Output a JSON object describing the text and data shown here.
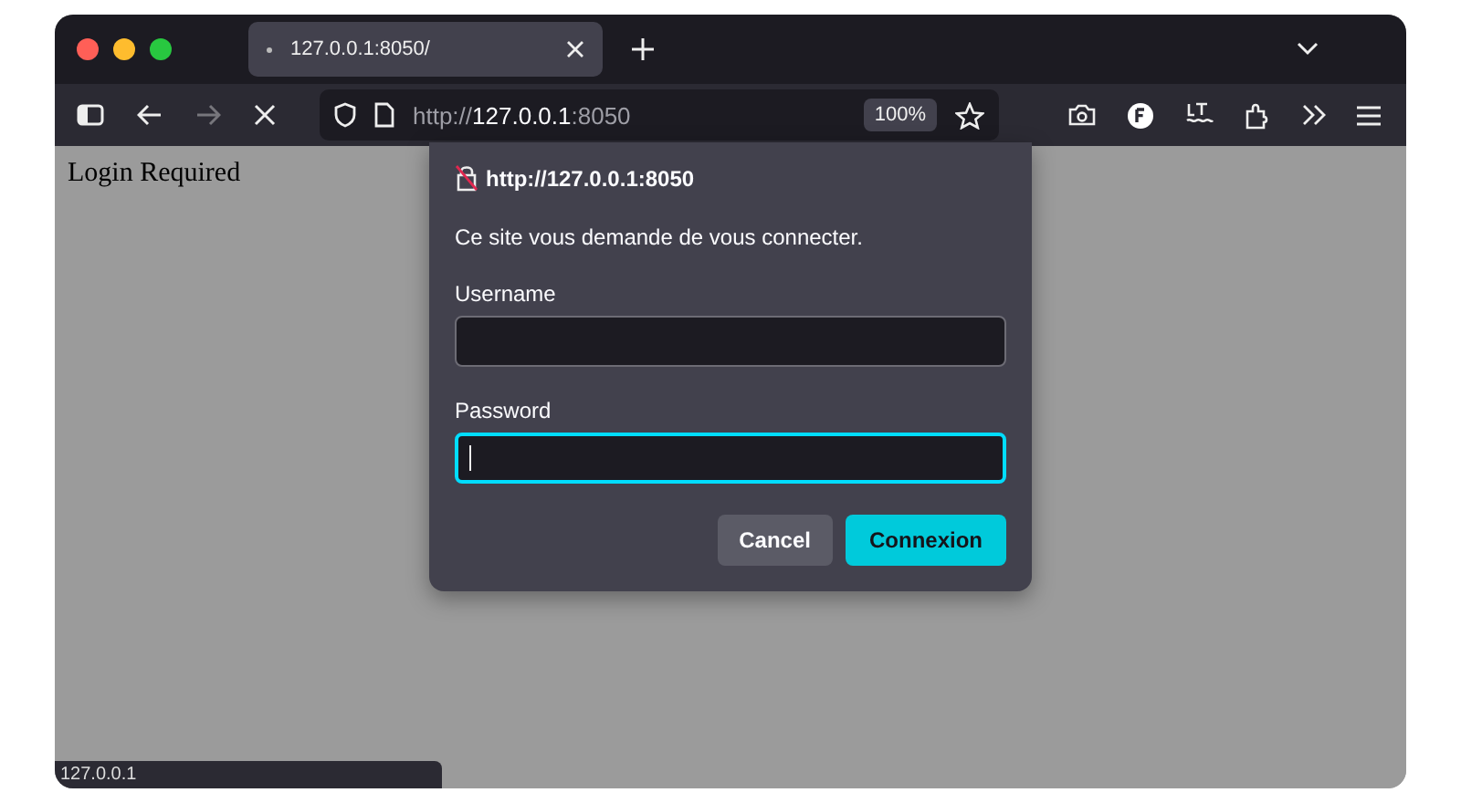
{
  "tab": {
    "title": "127.0.0.1:8050/",
    "selected": true
  },
  "address_bar": {
    "scheme": "http://",
    "host": "127.0.0.1",
    "port": ":8050",
    "zoom": "100%"
  },
  "page": {
    "text": "Login Required"
  },
  "dialog": {
    "origin": "http://127.0.0.1:8050",
    "message": "Ce site vous demande de vous connecter.",
    "fields": [
      {
        "label": "Username",
        "focused": false
      },
      {
        "label": "Password",
        "focused": true
      }
    ],
    "buttons": [
      {
        "label": "Cancel",
        "kind": "secondary"
      },
      {
        "label": "Connexion",
        "kind": "primary"
      }
    ]
  },
  "status_bar": "127.0.0.1"
}
